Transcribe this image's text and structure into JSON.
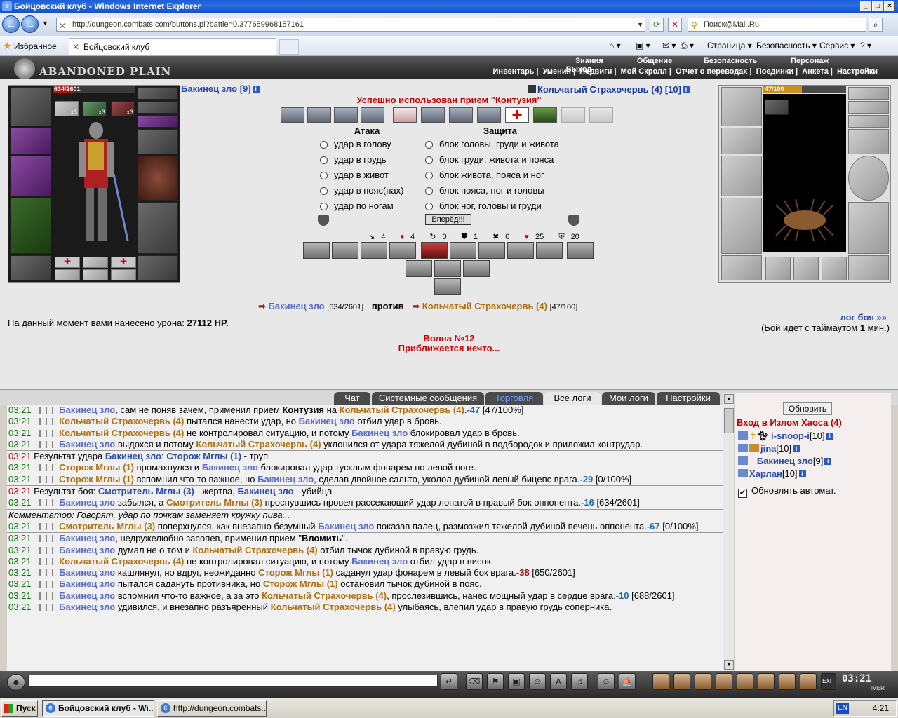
{
  "window": {
    "title": "Бойцовский клуб - Windows Internet Explorer"
  },
  "browser": {
    "url": "http://dungeon.combats.com/buttons.pl?battle=0.377659968157161",
    "search_placeholder": "Поиск@Mail.Ru",
    "favorites": "Избранное",
    "tab_title": "Бойцовский клуб",
    "commands": [
      "Страница",
      "Безопасность",
      "Сервис"
    ]
  },
  "game_nav": {
    "logo": "ABANDONED PLAIN",
    "row1": [
      "Знания",
      "Общение",
      "Безопасность",
      "Персонаж",
      "Выход"
    ],
    "row2": [
      "Инвентарь",
      "Умения",
      "Подвиги",
      "Мой Скролл",
      "Отчет о переводах",
      "Поединки",
      "Анкета",
      "Настройки"
    ]
  },
  "player": {
    "name": "Бакинец зло",
    "level": "[9]",
    "hp": "634/2601",
    "hp_fraction": 0.2437,
    "item_counts": [
      "x3",
      "x3",
      "x3"
    ]
  },
  "enemy": {
    "name": "Кольчатый Страхочервь",
    "level": "(4) [10]",
    "hp": "47/100",
    "hp_fraction": 0.47
  },
  "battle": {
    "message": "Успешно использован прием \"Контузия\"",
    "attack_header": "Атака",
    "defense_header": "Защита",
    "attacks": [
      "удар в голову",
      "удар в грудь",
      "удар в живот",
      "удар в пояс(пах)",
      "удар по ногам"
    ],
    "blocks": [
      "блок головы, груди и живота",
      "блок груди, живота и пояса",
      "блок живота, пояса и ног",
      "блок пояса, ног и головы",
      "блок ног, головы и груди"
    ],
    "go_button": "Вперёд!!!",
    "stats": [
      "4",
      "4",
      "0",
      "1",
      "0",
      "25",
      "20"
    ],
    "vs_player": "Бакинец зло",
    "vs_player_hp": "[634/2601]",
    "vs_word": "против",
    "vs_enemy": "Кольчатый Страхочервь (4)",
    "vs_enemy_hp": "[47/100]",
    "damage_label": "На данный момент вами нанесено урона:",
    "damage_value": "27112 HP.",
    "log_link": "лог боя »»",
    "timeout_pre": "(Бой идет с таймаутом",
    "timeout_val": "1",
    "timeout_post": "мин.)",
    "wave": "Волна №12",
    "wave_sub": "Приближается нечто..."
  },
  "chat_tabs": [
    "Чат",
    "Системные сообщения",
    "Торговля",
    "Все логи",
    "Мои логи",
    "Настройки"
  ],
  "log": [
    [
      "03:21",
      "Бакинец зло",
      ", сам не поняв зачем, применил прием ",
      "Контузия",
      " на ",
      "Кольчатый Страхочервь (4)",
      ".",
      "-47",
      " [47/100%]"
    ],
    [
      "03:21",
      "Кольчатый Страхочервь (4)",
      " пытался нанести удар, но ",
      "Бакинец зло",
      " отбил удар в бровь."
    ],
    [
      "03:21",
      "Кольчатый Страхочервь (4)",
      " не контролировал ситуацию, и потому ",
      "Бакинец зло",
      " блокировал удар в бровь."
    ],
    [
      "03:21",
      "Бакинец зло",
      " выдохся и потому ",
      "Кольчатый Страхочервь (4)",
      " уклонился от удара тяжелой дубиной в подбородок и приложил контрудар."
    ],
    [
      "03:21",
      "Результат удара ",
      "Бакинец зло",
      ": ",
      "Сторож Мглы (1)",
      " - труп"
    ],
    [
      "03:21",
      "Сторож Мглы (1)",
      " промахнулся и ",
      "Бакинец зло",
      " блокировал удар тусклым фонарем по левой ноге."
    ],
    [
      "03:21",
      "Сторож Мглы (1)",
      " вспомнил что-то важное, но ",
      "Бакинец зло",
      ", сделав двойное сальто, уколол дубиной левый бицепс врага.",
      "-29",
      " [0/100%]"
    ],
    [
      "03:21",
      "Результат боя: ",
      "Смотритель Мглы (3)",
      " - жертва, ",
      "Бакинец зло",
      " - убийца"
    ],
    [
      "03:21",
      "Бакинец зло",
      " забылся, а ",
      "Смотритель Мглы (3)",
      " проснувшись провел рассекающий удар лопатой в правый бок оппонента.",
      "-16",
      " [634/2601]"
    ],
    [
      "Комментатор: Говорят, удар по почкам заменяет кружку пива..."
    ],
    [
      "03:21",
      "Смотритель Мглы (3)",
      " поперхнулся, как внезапно безумный ",
      "Бакинец зло",
      " показав палец, размозжил тяжелой дубиной печень оппонента.",
      "-67",
      " [0/100%]"
    ],
    [
      "03:21",
      "Бакинец зло",
      ", недружелюбно засопев, применил прием \"",
      "Вломить",
      "\"."
    ],
    [
      "03:21",
      "Бакинец зло",
      " думал не о том и ",
      "Кольчатый Страхочервь (4)",
      " отбил тычок дубиной в правую грудь."
    ],
    [
      "03:21",
      "Кольчатый Страхочервь (4)",
      " не контролировал ситуацию, и потому ",
      "Бакинец зло",
      " отбил удар в висок."
    ],
    [
      "03:21",
      "Бакинец зло",
      " кашлянул, но вдруг, неожиданно ",
      "Сторож Мглы (1)",
      " саданул удар фонарем в левый бок врага.",
      "-38",
      " [650/2601]"
    ],
    [
      "03:21",
      "Бакинец зло",
      " пытался садануть противника, но ",
      "Сторож Мглы (1)",
      " остановил тычок дубиной в пояс."
    ],
    [
      "03:21",
      "Бакинец зло",
      " вспомнил что-то важное, а за это ",
      "Кольчатый Страхочервь (4)",
      ", прослезившись, нанес мощный удар в сердце врага.",
      "-10",
      " [688/2601]"
    ],
    [
      "03:21",
      "Бакинец зло",
      " удивился, и внезапно разъяренный ",
      "Кольчатый Страхочервь (4)",
      " улыбаясь, влепил удар в правую грудь соперника."
    ]
  ],
  "side": {
    "refresh": "Обновить",
    "room": "Вход в Излом Хаоса (4)",
    "players": [
      {
        "name": "i-snoop-i",
        "level": "[10]"
      },
      {
        "name": "jina",
        "level": "[10]"
      },
      {
        "name": "Бакинец зло",
        "level": "[9]"
      },
      {
        "name": "Харлан",
        "level": "[10]"
      }
    ],
    "auto_update": "Обновлять автомат."
  },
  "clock": {
    "time": "03:21",
    "label": "TIMER"
  },
  "taskbar": {
    "start": "Пуск",
    "task1": "Бойцовский клуб - Wi...",
    "task2": "http://dungeon.combats...",
    "lang": "EN",
    "time": "4:21"
  },
  "colors": {
    "player_name": "#5a6ac8",
    "enemy_name": "#b07010",
    "alert": "#d00000",
    "timestamp": "#0a7a0a"
  }
}
